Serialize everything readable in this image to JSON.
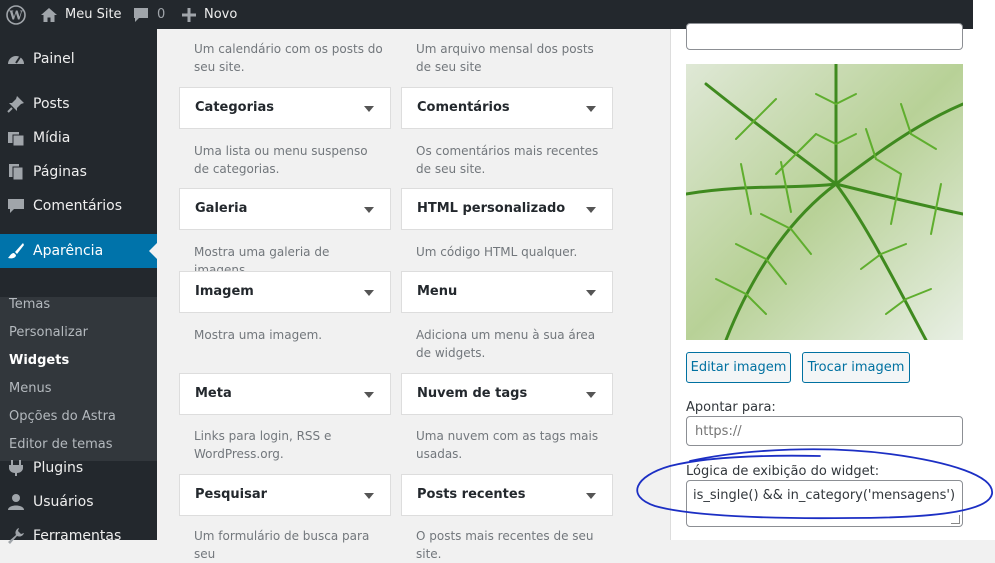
{
  "adminbar": {
    "site_name": "Meu Site",
    "comments_count": "0",
    "new_label": "Novo"
  },
  "sidebar": {
    "painel": "Painel",
    "posts": "Posts",
    "midia": "Mídia",
    "paginas": "Páginas",
    "comentarios": "Comentários",
    "aparencia": "Aparência",
    "sub": {
      "temas": "Temas",
      "personalizar": "Personalizar",
      "widgets": "Widgets",
      "menus": "Menus",
      "astra": "Opções do Astra",
      "editor": "Editor de temas"
    },
    "plugins": "Plugins",
    "usuarios": "Usuários",
    "ferramentas": "Ferramentas"
  },
  "widgets": {
    "top_desc_left": "Um calendário com os posts do seu site.",
    "top_desc_right": "Um arquivo mensal dos posts de seu site",
    "items": [
      {
        "title": "Categorias",
        "desc": "Uma lista ou menu suspenso de categorias."
      },
      {
        "title": "Comentários",
        "desc": "Os comentários mais recentes de seu site."
      },
      {
        "title": "Galeria",
        "desc": "Mostra uma galeria de imagens."
      },
      {
        "title": "HTML personalizado",
        "desc": "Um código HTML qualquer."
      },
      {
        "title": "Imagem",
        "desc": "Mostra uma imagem."
      },
      {
        "title": "Menu",
        "desc": "Adiciona um menu à sua área de widgets."
      },
      {
        "title": "Meta",
        "desc": "Links para login, RSS e WordPress.org."
      },
      {
        "title": "Nuvem de tags",
        "desc": "Uma nuvem com as tags mais usadas."
      },
      {
        "title": "Pesquisar",
        "desc": "Um formulário de busca para seu"
      },
      {
        "title": "Posts recentes",
        "desc": "O posts mais recentes de seu site."
      }
    ]
  },
  "panel": {
    "edit_image": "Editar imagem",
    "replace_image": "Trocar imagem",
    "link_label": "Apontar para:",
    "link_placeholder": "https://",
    "logic_label": "Lógica de exibição do widget:",
    "logic_value": "is_single() && in_category('mensagens')"
  },
  "colors": {
    "admin_dark": "#23282d",
    "active_blue": "#0073aa",
    "button_blue": "#0071a1",
    "annotation_blue": "#1c2fc4"
  }
}
